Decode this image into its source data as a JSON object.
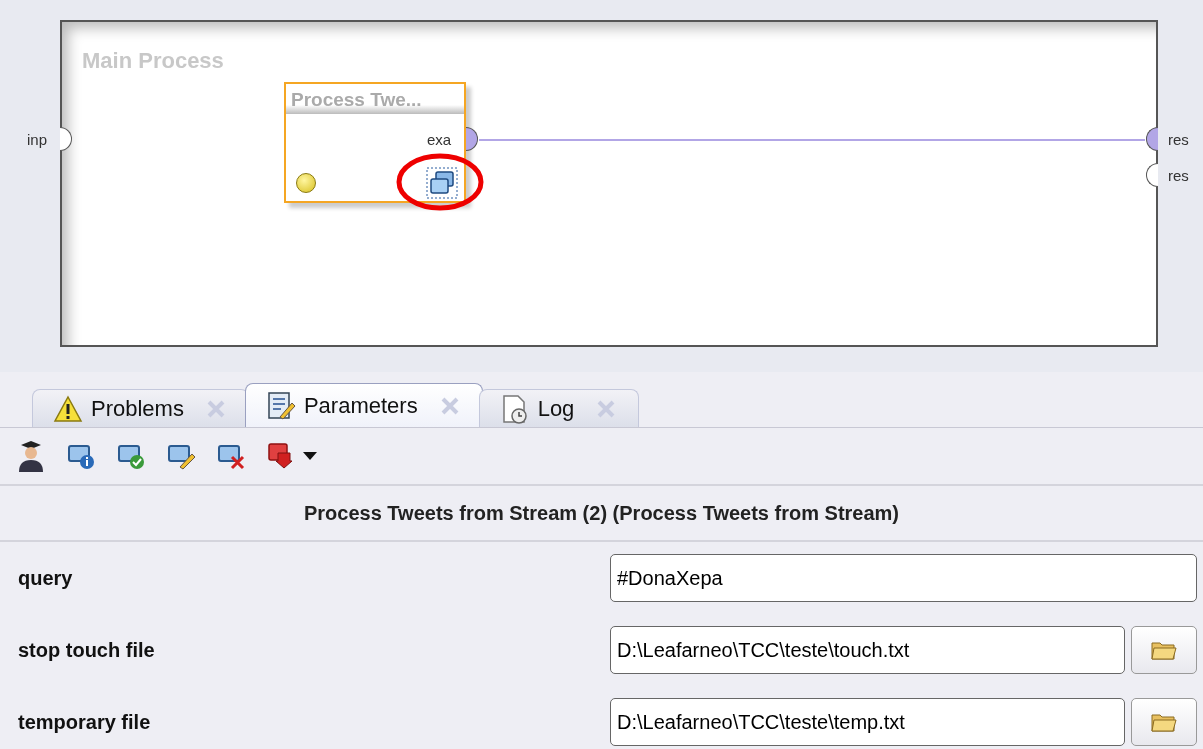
{
  "process": {
    "title": "Main Process",
    "input_ports": [
      {
        "label": "inp",
        "connected": false
      }
    ],
    "output_ports": [
      {
        "label": "res",
        "connected": true
      },
      {
        "label": "res",
        "connected": false
      }
    ]
  },
  "operator": {
    "title": "Process Twe...",
    "output_ports": [
      {
        "label": "exa",
        "connected": true
      }
    ]
  },
  "tabs": [
    {
      "label": "Problems",
      "kind": "problems",
      "selected": false
    },
    {
      "label": "Parameters",
      "kind": "parameters",
      "selected": true
    },
    {
      "label": "Log",
      "kind": "log",
      "selected": false
    }
  ],
  "parameters": {
    "heading": "Process Tweets from Stream (2) (Process Tweets from Stream)",
    "rows": [
      {
        "label": "query",
        "kind": "text",
        "value": "#DonaXepa"
      },
      {
        "label": "stop touch file",
        "kind": "file",
        "value": "D:\\Leafarneo\\TCC\\teste\\touch.txt"
      },
      {
        "label": "temporary file",
        "kind": "file",
        "value": "D:\\Leafarneo\\TCC\\teste\\temp.txt"
      }
    ]
  }
}
